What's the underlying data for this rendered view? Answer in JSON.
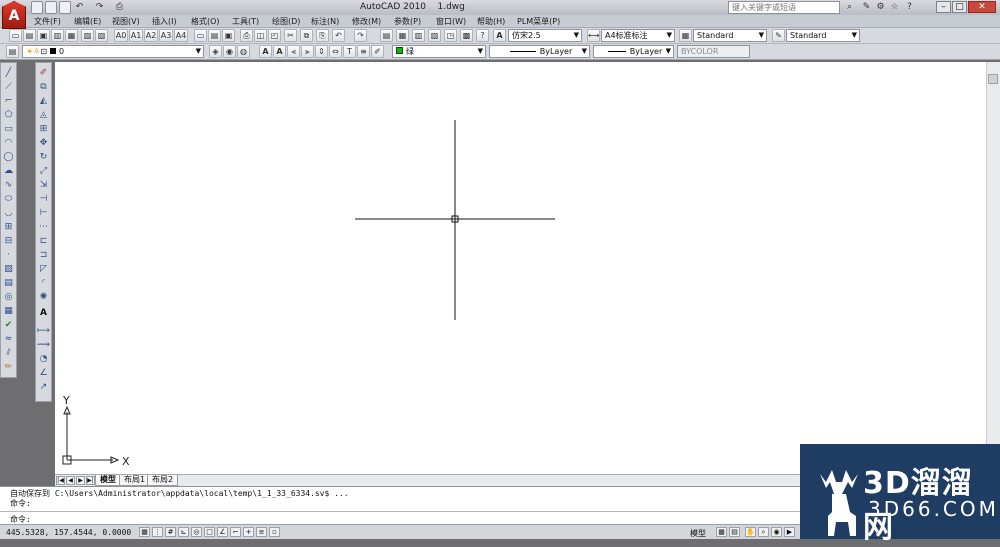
{
  "app": {
    "logo": "A",
    "title": "AutoCAD 2010",
    "document": "1.dwg",
    "help_search_placeholder": "键入关键字或短语"
  },
  "menu": [
    "文件(F)",
    "编辑(E)",
    "视图(V)",
    "插入(I)",
    "格式(O)",
    "工具(T)",
    "绘图(D)",
    "标注(N)",
    "修改(M)",
    "参数(P)",
    "窗口(W)",
    "帮助(H)",
    "PLM菜单(P)"
  ],
  "toolbar_top": {
    "text_buttons": [
      "A0",
      "A1",
      "A2",
      "A3",
      "A4"
    ],
    "text_style": "仿宋2.5",
    "dim_style": "A4标准标注",
    "table_style": "Standard",
    "multileader_style": "Standard"
  },
  "toolbar_layers": {
    "current_layer": "0",
    "color": "绿",
    "color_hex": "#00c000",
    "linetype": "ByLayer",
    "lineweight": "ByLayer",
    "plot_style": "BYCOLOR"
  },
  "ucs": {
    "x_label": "X",
    "y_label": "Y"
  },
  "tabs": [
    "模型",
    "布局1",
    "布局2"
  ],
  "command": {
    "history": [
      "自动保存到 C:\\Users\\Administrator\\appdata\\local\\temp\\1_1_33_6334.sv$ ...",
      "命令:"
    ],
    "prompt": "命令:"
  },
  "status": {
    "coords": "445.5328, 157.4544, 0.0000",
    "model_label": "模型"
  },
  "watermark": {
    "big": "3D溜溜网",
    "small": "3D66.COM"
  }
}
